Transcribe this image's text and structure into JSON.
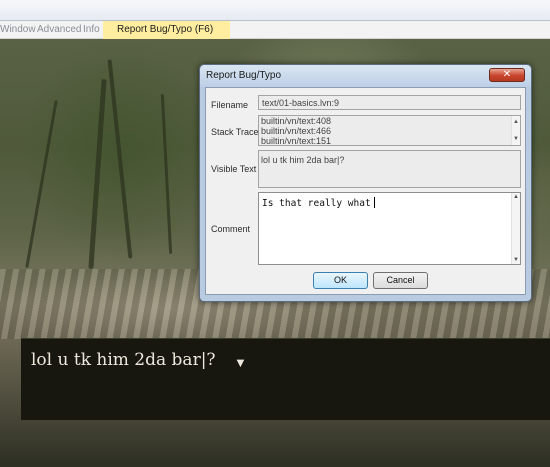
{
  "menu": {
    "items": [
      "Window",
      "Advanced",
      "Info"
    ],
    "highlight": "Report Bug/Typo (F6)"
  },
  "dialog": {
    "title": "Report Bug/Typo",
    "close_icon": "x-icon",
    "labels": {
      "filename": "Filename",
      "stack": "Stack Trace",
      "visible": "Visible Text",
      "comment": "Comment"
    },
    "filename": "text/01-basics.lvn:9",
    "stack_trace": [
      "builtin/vn/text:408",
      "builtin/vn/text:466",
      "builtin/vn/text:151"
    ],
    "visible_text": "lol u tk him 2da bar|?",
    "comment": "Is that really what",
    "ok_label": "OK",
    "cancel_label": "Cancel"
  },
  "textbox": {
    "line": "lol u tk him 2da bar|?",
    "arrow_icon": "advance-arrow-icon"
  },
  "colors": {
    "menu_highlight": "#ffeea0",
    "dialog_frame": "#b9cbe0",
    "close_button": "#c8452c",
    "textbox_bg": "#17170f"
  }
}
